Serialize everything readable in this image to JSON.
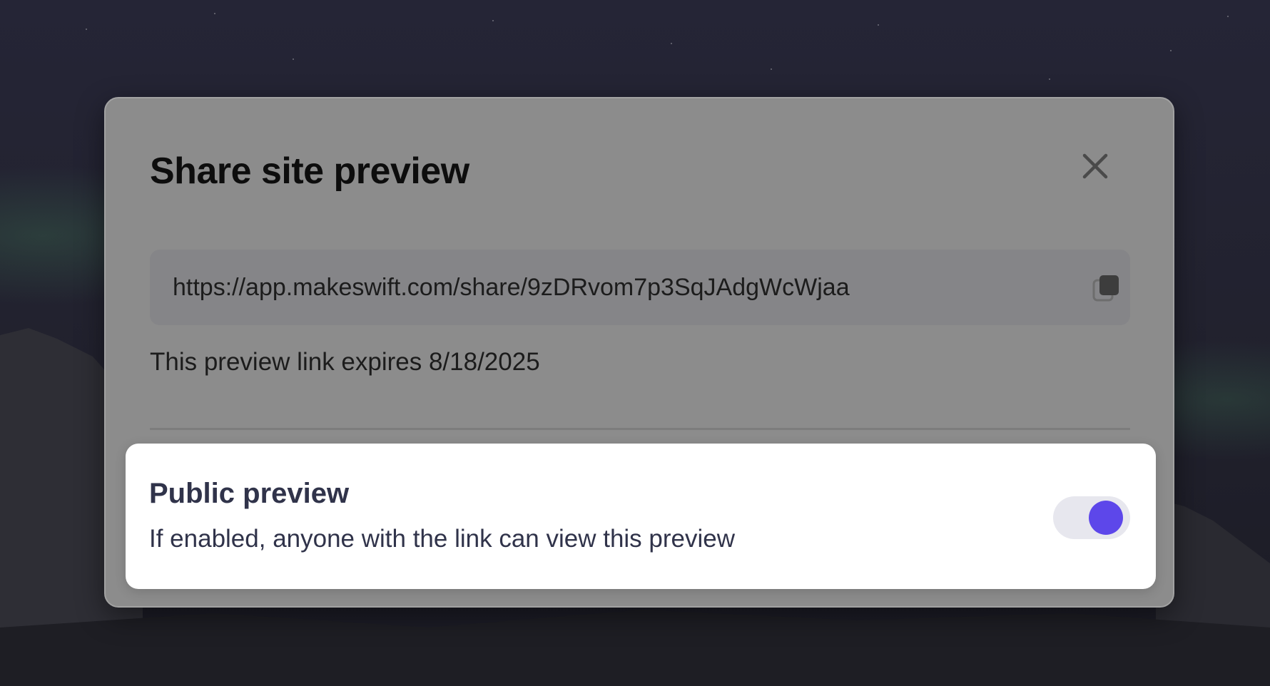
{
  "dialog": {
    "title": "Share site preview",
    "close_icon": "close-icon",
    "share_url": "https://app.makeswift.com/share/9zDRvom7p3SqJAdgWcWjaa",
    "copy_icon": "copy-icon",
    "expiry_text": "This preview link expires 8/18/2025"
  },
  "public_preview": {
    "title": "Public preview",
    "description": "If enabled, anyone with the link can view this preview",
    "enabled": true
  },
  "colors": {
    "accent": "#5d47ea",
    "dialog_bg": "#8c8c8c",
    "card_bg": "#ffffff",
    "text_dark": "#30334a"
  }
}
